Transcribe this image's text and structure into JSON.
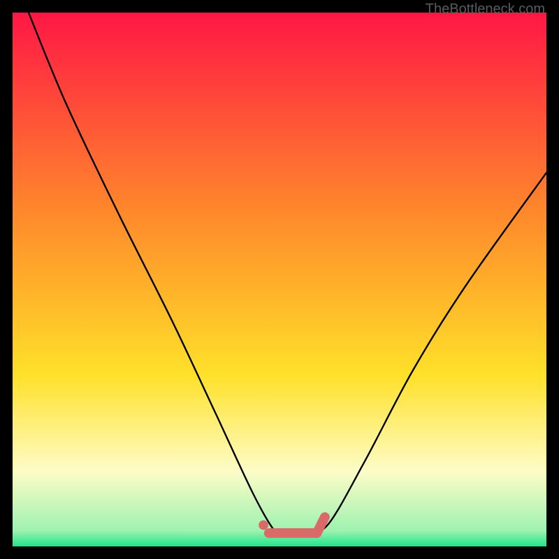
{
  "watermark": "TheBottleneck.com",
  "colors": {
    "gradient_top": "#ff1745",
    "gradient_mid1": "#ff6b2d",
    "gradient_mid2": "#ffe12a",
    "gradient_lower": "#fdfcc7",
    "gradient_bottom": "#1ee58b",
    "curve": "#000000",
    "marker": "#d96a68",
    "frame": "#000000"
  },
  "chart_data": {
    "type": "line",
    "title": "",
    "xlabel": "",
    "ylabel": "",
    "xlim": [
      0,
      100
    ],
    "ylim": [
      0,
      100
    ],
    "series": [
      {
        "name": "bottleneck-curve",
        "x": [
          3,
          10,
          20,
          30,
          38,
          45,
          49,
          51,
          55,
          59,
          66,
          75,
          85,
          100
        ],
        "y": [
          100,
          83,
          62,
          42,
          25,
          10,
          3,
          2,
          3,
          4,
          16,
          33,
          49,
          70
        ]
      }
    ],
    "markers": [
      {
        "name": "valley-left-dot",
        "x": 47,
        "y": 4,
        "r": 0.9
      },
      {
        "name": "valley-bridge",
        "type": "segment",
        "x1": 48,
        "y1": 2.5,
        "x2": 57,
        "y2": 2.5,
        "width": 1.8
      },
      {
        "name": "valley-right-cap",
        "type": "segment",
        "x1": 57,
        "y1": 2.5,
        "x2": 58.5,
        "y2": 5.5,
        "width": 1.8
      }
    ],
    "annotations": []
  }
}
